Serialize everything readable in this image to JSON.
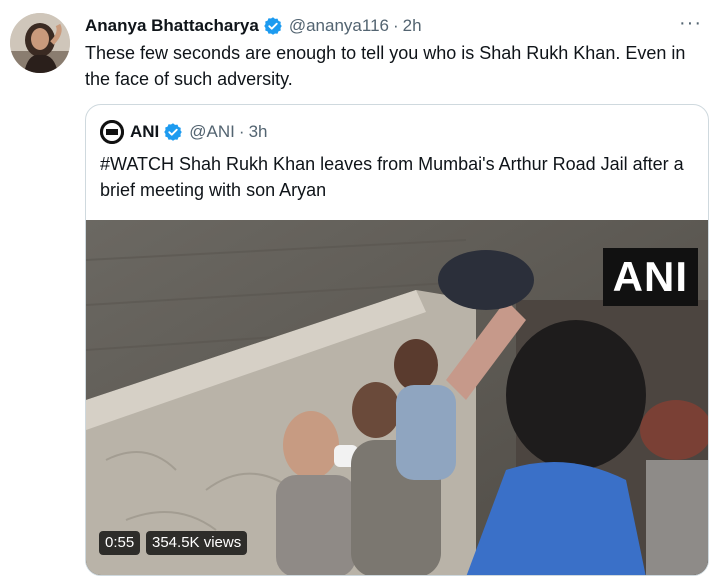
{
  "tweet": {
    "author_name": "Ananya Bhattacharya",
    "handle": "@ananya116",
    "separator": "·",
    "time": "2h",
    "text": "These few seconds are enough to tell you who is Shah Rukh Khan. Even in the face of such adversity.",
    "more_icon": "···"
  },
  "quoted_tweet": {
    "author_name": "ANI",
    "handle": "@ANI",
    "separator": "·",
    "time": "3h",
    "text": "#WATCH Shah Rukh Khan leaves from Mumbai's Arthur Road Jail after a brief meeting with son Aryan",
    "media": {
      "watermark": "ANI",
      "duration": "0:55",
      "views": "354.5K views"
    }
  },
  "colors": {
    "verified_blue": "#1d9bf0",
    "text_primary": "#0f1419",
    "text_secondary": "#536471",
    "border": "#cfd9de"
  },
  "icons": [
    "verified-badge-icon",
    "more-options-icon",
    "ani-logo-icon"
  ]
}
